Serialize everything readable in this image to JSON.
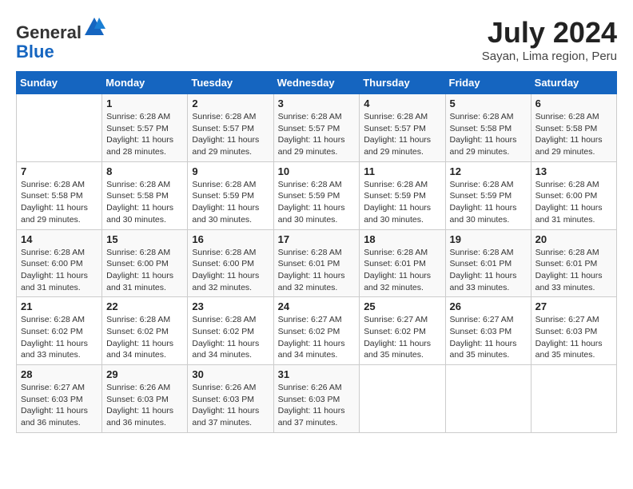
{
  "logo": {
    "general": "General",
    "blue": "Blue"
  },
  "title": {
    "month_year": "July 2024",
    "location": "Sayan, Lima region, Peru"
  },
  "days_of_week": [
    "Sunday",
    "Monday",
    "Tuesday",
    "Wednesday",
    "Thursday",
    "Friday",
    "Saturday"
  ],
  "weeks": [
    [
      {
        "day": "",
        "info": ""
      },
      {
        "day": "1",
        "info": "Sunrise: 6:28 AM\nSunset: 5:57 PM\nDaylight: 11 hours\nand 28 minutes."
      },
      {
        "day": "2",
        "info": "Sunrise: 6:28 AM\nSunset: 5:57 PM\nDaylight: 11 hours\nand 29 minutes."
      },
      {
        "day": "3",
        "info": "Sunrise: 6:28 AM\nSunset: 5:57 PM\nDaylight: 11 hours\nand 29 minutes."
      },
      {
        "day": "4",
        "info": "Sunrise: 6:28 AM\nSunset: 5:57 PM\nDaylight: 11 hours\nand 29 minutes."
      },
      {
        "day": "5",
        "info": "Sunrise: 6:28 AM\nSunset: 5:58 PM\nDaylight: 11 hours\nand 29 minutes."
      },
      {
        "day": "6",
        "info": "Sunrise: 6:28 AM\nSunset: 5:58 PM\nDaylight: 11 hours\nand 29 minutes."
      }
    ],
    [
      {
        "day": "7",
        "info": "Sunrise: 6:28 AM\nSunset: 5:58 PM\nDaylight: 11 hours\nand 29 minutes."
      },
      {
        "day": "8",
        "info": "Sunrise: 6:28 AM\nSunset: 5:58 PM\nDaylight: 11 hours\nand 30 minutes."
      },
      {
        "day": "9",
        "info": "Sunrise: 6:28 AM\nSunset: 5:59 PM\nDaylight: 11 hours\nand 30 minutes."
      },
      {
        "day": "10",
        "info": "Sunrise: 6:28 AM\nSunset: 5:59 PM\nDaylight: 11 hours\nand 30 minutes."
      },
      {
        "day": "11",
        "info": "Sunrise: 6:28 AM\nSunset: 5:59 PM\nDaylight: 11 hours\nand 30 minutes."
      },
      {
        "day": "12",
        "info": "Sunrise: 6:28 AM\nSunset: 5:59 PM\nDaylight: 11 hours\nand 30 minutes."
      },
      {
        "day": "13",
        "info": "Sunrise: 6:28 AM\nSunset: 6:00 PM\nDaylight: 11 hours\nand 31 minutes."
      }
    ],
    [
      {
        "day": "14",
        "info": "Sunrise: 6:28 AM\nSunset: 6:00 PM\nDaylight: 11 hours\nand 31 minutes."
      },
      {
        "day": "15",
        "info": "Sunrise: 6:28 AM\nSunset: 6:00 PM\nDaylight: 11 hours\nand 31 minutes."
      },
      {
        "day": "16",
        "info": "Sunrise: 6:28 AM\nSunset: 6:00 PM\nDaylight: 11 hours\nand 32 minutes."
      },
      {
        "day": "17",
        "info": "Sunrise: 6:28 AM\nSunset: 6:01 PM\nDaylight: 11 hours\nand 32 minutes."
      },
      {
        "day": "18",
        "info": "Sunrise: 6:28 AM\nSunset: 6:01 PM\nDaylight: 11 hours\nand 32 minutes."
      },
      {
        "day": "19",
        "info": "Sunrise: 6:28 AM\nSunset: 6:01 PM\nDaylight: 11 hours\nand 33 minutes."
      },
      {
        "day": "20",
        "info": "Sunrise: 6:28 AM\nSunset: 6:01 PM\nDaylight: 11 hours\nand 33 minutes."
      }
    ],
    [
      {
        "day": "21",
        "info": "Sunrise: 6:28 AM\nSunset: 6:02 PM\nDaylight: 11 hours\nand 33 minutes."
      },
      {
        "day": "22",
        "info": "Sunrise: 6:28 AM\nSunset: 6:02 PM\nDaylight: 11 hours\nand 34 minutes."
      },
      {
        "day": "23",
        "info": "Sunrise: 6:28 AM\nSunset: 6:02 PM\nDaylight: 11 hours\nand 34 minutes."
      },
      {
        "day": "24",
        "info": "Sunrise: 6:27 AM\nSunset: 6:02 PM\nDaylight: 11 hours\nand 34 minutes."
      },
      {
        "day": "25",
        "info": "Sunrise: 6:27 AM\nSunset: 6:02 PM\nDaylight: 11 hours\nand 35 minutes."
      },
      {
        "day": "26",
        "info": "Sunrise: 6:27 AM\nSunset: 6:03 PM\nDaylight: 11 hours\nand 35 minutes."
      },
      {
        "day": "27",
        "info": "Sunrise: 6:27 AM\nSunset: 6:03 PM\nDaylight: 11 hours\nand 35 minutes."
      }
    ],
    [
      {
        "day": "28",
        "info": "Sunrise: 6:27 AM\nSunset: 6:03 PM\nDaylight: 11 hours\nand 36 minutes."
      },
      {
        "day": "29",
        "info": "Sunrise: 6:26 AM\nSunset: 6:03 PM\nDaylight: 11 hours\nand 36 minutes."
      },
      {
        "day": "30",
        "info": "Sunrise: 6:26 AM\nSunset: 6:03 PM\nDaylight: 11 hours\nand 37 minutes."
      },
      {
        "day": "31",
        "info": "Sunrise: 6:26 AM\nSunset: 6:03 PM\nDaylight: 11 hours\nand 37 minutes."
      },
      {
        "day": "",
        "info": ""
      },
      {
        "day": "",
        "info": ""
      },
      {
        "day": "",
        "info": ""
      }
    ]
  ]
}
